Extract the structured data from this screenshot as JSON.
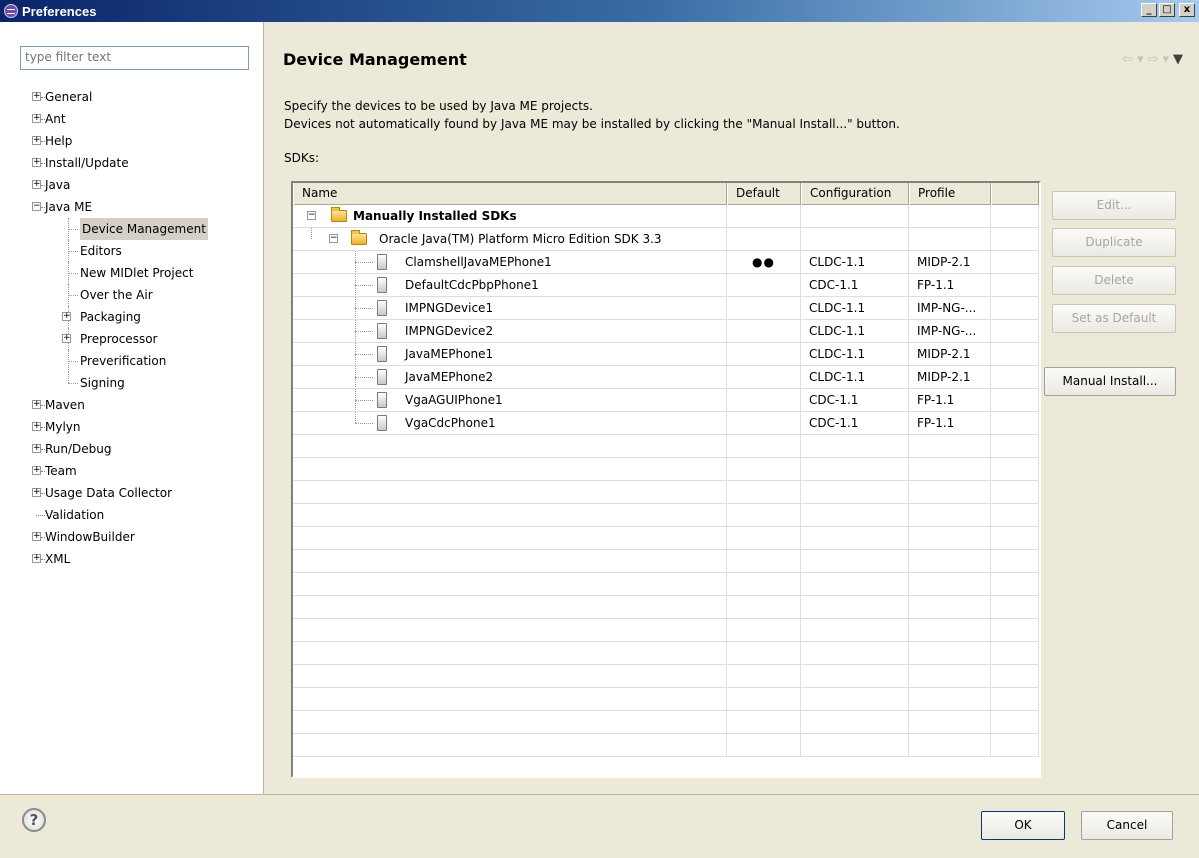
{
  "window": {
    "title": "Preferences",
    "minimize": "_",
    "maximize": "□",
    "close": "x"
  },
  "filter": {
    "placeholder": "type filter text"
  },
  "tree": {
    "general": "General",
    "ant": "Ant",
    "help": "Help",
    "install_update": "Install/Update",
    "java": "Java",
    "java_me": "Java ME",
    "java_me_children": {
      "device_management": "Device Management",
      "editors": "Editors",
      "new_midlet_project": "New MIDlet Project",
      "over_the_air": "Over the Air",
      "packaging": "Packaging",
      "preprocessor": "Preprocessor",
      "preverification": "Preverification",
      "signing": "Signing"
    },
    "maven": "Maven",
    "mylyn": "Mylyn",
    "run_debug": "Run/Debug",
    "team": "Team",
    "usage_data_collector": "Usage Data Collector",
    "validation": "Validation",
    "windowbuilder": "WindowBuilder",
    "xml": "XML"
  },
  "page": {
    "title": "Device Management",
    "description_line1": "Specify the devices to be used by Java ME projects.",
    "description_line2": "Devices not automatically found by Java ME may be installed by clicking the \"Manual Install...\" button.",
    "sdks_label": "SDKs:"
  },
  "table": {
    "headers": {
      "name": "Name",
      "default": "Default",
      "configuration": "Configuration",
      "profile": "Profile"
    },
    "group": "Manually Installed SDKs",
    "sdk": "Oracle Java(TM) Platform Micro Edition SDK 3.3",
    "devices": [
      {
        "name": "ClamshellJavaMEPhone1",
        "default": "●●",
        "config": "CLDC-1.1",
        "profile": "MIDP-2.1"
      },
      {
        "name": "DefaultCdcPbpPhone1",
        "default": "",
        "config": "CDC-1.1",
        "profile": "FP-1.1"
      },
      {
        "name": "IMPNGDevice1",
        "default": "",
        "config": "CLDC-1.1",
        "profile": "IMP-NG-..."
      },
      {
        "name": "IMPNGDevice2",
        "default": "",
        "config": "CLDC-1.1",
        "profile": "IMP-NG-..."
      },
      {
        "name": "JavaMEPhone1",
        "default": "",
        "config": "CLDC-1.1",
        "profile": "MIDP-2.1"
      },
      {
        "name": "JavaMEPhone2",
        "default": "",
        "config": "CLDC-1.1",
        "profile": "MIDP-2.1"
      },
      {
        "name": "VgaAGUIPhone1",
        "default": "",
        "config": "CDC-1.1",
        "profile": "FP-1.1"
      },
      {
        "name": "VgaCdcPhone1",
        "default": "",
        "config": "CDC-1.1",
        "profile": "FP-1.1"
      }
    ]
  },
  "buttons": {
    "edit": "Edit...",
    "duplicate": "Duplicate",
    "delete": "Delete",
    "set_default": "Set as Default",
    "manual_install": "Manual Install...",
    "ok": "OK",
    "cancel": "Cancel",
    "help": "?"
  },
  "nav": {
    "back": "⇦",
    "forward": "⇨",
    "dropdown": "▾",
    "menu": "▼"
  }
}
